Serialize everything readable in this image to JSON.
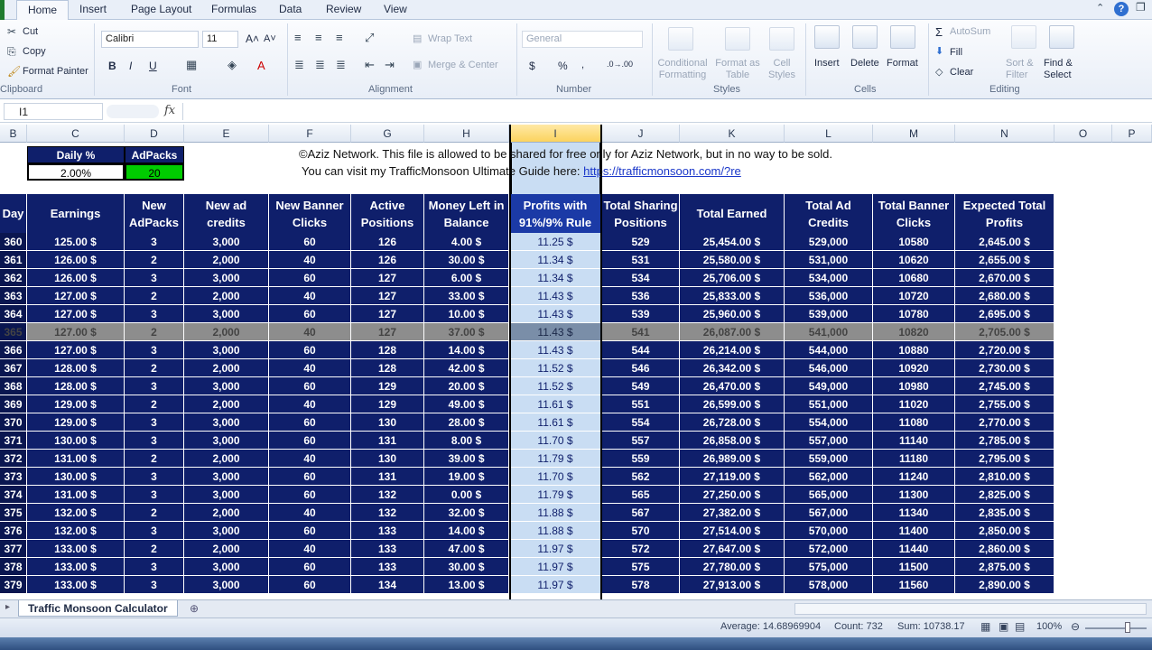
{
  "ribbon": {
    "tabs": [
      "Home",
      "Insert",
      "Page Layout",
      "Formulas",
      "Data",
      "Review",
      "View"
    ],
    "clipboard": {
      "cut": "Cut",
      "copy": "Copy",
      "format_painter": "Format Painter",
      "label": "Clipboard"
    },
    "font": {
      "name": "Calibri",
      "size": "11",
      "bold": "B",
      "italic": "I",
      "underline": "U",
      "label": "Font"
    },
    "alignment": {
      "wrap": "Wrap Text",
      "merge": "Merge & Center",
      "label": "Alignment"
    },
    "number": {
      "format": "General",
      "currency": "$",
      "percent": "%",
      "label": "Number"
    },
    "styles": {
      "cond": "Conditional Formatting",
      "format_table": "Format as Table",
      "cell_styles": "Cell Styles",
      "label": "Styles"
    },
    "cells": {
      "insert": "Insert",
      "delete": "Delete",
      "format": "Format",
      "label": "Cells"
    },
    "editing": {
      "autosum": "AutoSum",
      "fill": "Fill",
      "clear": "Clear",
      "sort": "Sort & Filter",
      "find": "Find & Select",
      "label": "Editing"
    }
  },
  "formula_bar": {
    "name_box": "I1",
    "fx": "fx"
  },
  "columns": [
    "B",
    "C",
    "D",
    "E",
    "F",
    "G",
    "H",
    "I",
    "J",
    "K",
    "L",
    "M",
    "N",
    "O",
    "P"
  ],
  "top_box": {
    "daily_label": "Daily %",
    "daily_value": "2.00%",
    "adpacks_label": "AdPacks",
    "adpacks_value": "20"
  },
  "notice": {
    "line1": "©Aziz Network. This file is allowed to be shared for free only for Aziz Network, but in no way to be sold.",
    "line2": "You can visit my TrafficMonsoon Ultimate Guide here: ",
    "link": "https://trafficmonsoon.com/?re"
  },
  "headers": [
    "Day",
    "Earnings",
    "New\nAdPacks",
    "New ad\ncredits",
    "New Banner\nClicks",
    "Active\nPositions",
    "Money Left in\nBalance",
    "Profits with\n91%/9% Rule",
    "Total Sharing\nPositions",
    "Total Earned",
    "Total Ad\nCredits",
    "Total Banner\nClicks",
    "Expected Total\nProfits"
  ],
  "rows": [
    [
      "360",
      "125.00 $",
      "3",
      "3,000",
      "60",
      "126",
      "4.00 $",
      "11.25 $",
      "529",
      "25,454.00 $",
      "529,000",
      "10580",
      "2,645.00 $"
    ],
    [
      "361",
      "126.00 $",
      "2",
      "2,000",
      "40",
      "126",
      "30.00 $",
      "11.34 $",
      "531",
      "25,580.00 $",
      "531,000",
      "10620",
      "2,655.00 $"
    ],
    [
      "362",
      "126.00 $",
      "3",
      "3,000",
      "60",
      "127",
      "6.00 $",
      "11.34 $",
      "534",
      "25,706.00 $",
      "534,000",
      "10680",
      "2,670.00 $"
    ],
    [
      "363",
      "127.00 $",
      "2",
      "2,000",
      "40",
      "127",
      "33.00 $",
      "11.43 $",
      "536",
      "25,833.00 $",
      "536,000",
      "10720",
      "2,680.00 $"
    ],
    [
      "364",
      "127.00 $",
      "3",
      "3,000",
      "60",
      "127",
      "10.00 $",
      "11.43 $",
      "539",
      "25,960.00 $",
      "539,000",
      "10780",
      "2,695.00 $"
    ],
    [
      "365",
      "127.00 $",
      "2",
      "2,000",
      "40",
      "127",
      "37.00 $",
      "11.43 $",
      "541",
      "26,087.00 $",
      "541,000",
      "10820",
      "2,705.00 $"
    ],
    [
      "366",
      "127.00 $",
      "3",
      "3,000",
      "60",
      "128",
      "14.00 $",
      "11.43 $",
      "544",
      "26,214.00 $",
      "544,000",
      "10880",
      "2,720.00 $"
    ],
    [
      "367",
      "128.00 $",
      "2",
      "2,000",
      "40",
      "128",
      "42.00 $",
      "11.52 $",
      "546",
      "26,342.00 $",
      "546,000",
      "10920",
      "2,730.00 $"
    ],
    [
      "368",
      "128.00 $",
      "3",
      "3,000",
      "60",
      "129",
      "20.00 $",
      "11.52 $",
      "549",
      "26,470.00 $",
      "549,000",
      "10980",
      "2,745.00 $"
    ],
    [
      "369",
      "129.00 $",
      "2",
      "2,000",
      "40",
      "129",
      "49.00 $",
      "11.61 $",
      "551",
      "26,599.00 $",
      "551,000",
      "11020",
      "2,755.00 $"
    ],
    [
      "370",
      "129.00 $",
      "3",
      "3,000",
      "60",
      "130",
      "28.00 $",
      "11.61 $",
      "554",
      "26,728.00 $",
      "554,000",
      "11080",
      "2,770.00 $"
    ],
    [
      "371",
      "130.00 $",
      "3",
      "3,000",
      "60",
      "131",
      "8.00 $",
      "11.70 $",
      "557",
      "26,858.00 $",
      "557,000",
      "11140",
      "2,785.00 $"
    ],
    [
      "372",
      "131.00 $",
      "2",
      "2,000",
      "40",
      "130",
      "39.00 $",
      "11.79 $",
      "559",
      "26,989.00 $",
      "559,000",
      "11180",
      "2,795.00 $"
    ],
    [
      "373",
      "130.00 $",
      "3",
      "3,000",
      "60",
      "131",
      "19.00 $",
      "11.70 $",
      "562",
      "27,119.00 $",
      "562,000",
      "11240",
      "2,810.00 $"
    ],
    [
      "374",
      "131.00 $",
      "3",
      "3,000",
      "60",
      "132",
      "0.00 $",
      "11.79 $",
      "565",
      "27,250.00 $",
      "565,000",
      "11300",
      "2,825.00 $"
    ],
    [
      "375",
      "132.00 $",
      "2",
      "2,000",
      "40",
      "132",
      "32.00 $",
      "11.88 $",
      "567",
      "27,382.00 $",
      "567,000",
      "11340",
      "2,835.00 $"
    ],
    [
      "376",
      "132.00 $",
      "3",
      "3,000",
      "60",
      "133",
      "14.00 $",
      "11.88 $",
      "570",
      "27,514.00 $",
      "570,000",
      "11400",
      "2,850.00 $"
    ],
    [
      "377",
      "133.00 $",
      "2",
      "2,000",
      "40",
      "133",
      "47.00 $",
      "11.97 $",
      "572",
      "27,647.00 $",
      "572,000",
      "11440",
      "2,860.00 $"
    ],
    [
      "378",
      "133.00 $",
      "3",
      "3,000",
      "60",
      "133",
      "30.00 $",
      "11.97 $",
      "575",
      "27,780.00 $",
      "575,000",
      "11500",
      "2,875.00 $"
    ],
    [
      "379",
      "133.00 $",
      "3",
      "3,000",
      "60",
      "134",
      "13.00 $",
      "11.97 $",
      "578",
      "27,913.00 $",
      "578,000",
      "11560",
      "2,890.00 $"
    ]
  ],
  "highlight_row": 5,
  "sheet_tab": "Traffic Monsoon Calculator",
  "status": {
    "average": "Average: 14.68969904",
    "count": "Count: 732",
    "sum": "Sum: 10738.17",
    "zoom": "100%"
  },
  "colors": {
    "header_bg": "#0f1f6b",
    "adpacks_green": "#00cc00",
    "selection": "#c9ddf3",
    "highlight_row": "#8d8d8d"
  }
}
